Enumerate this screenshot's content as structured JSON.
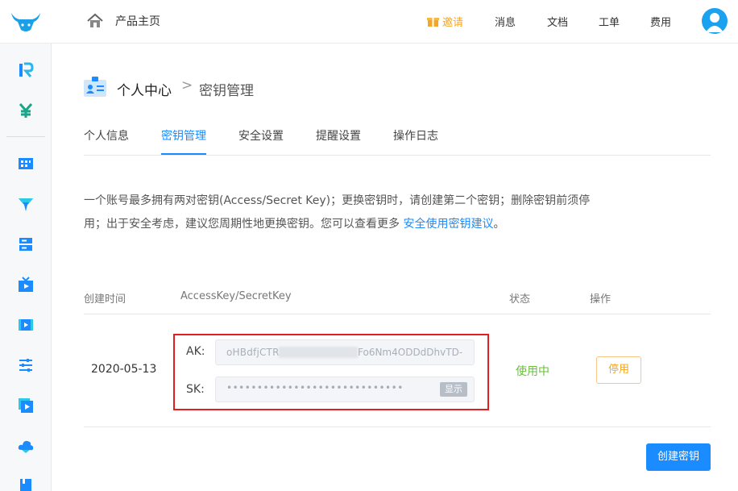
{
  "header": {
    "home_label": "产品主页",
    "nav": {
      "invite": "邀请",
      "messages": "消息",
      "docs": "文档",
      "tickets": "工单",
      "billing": "费用"
    }
  },
  "sidebar": {
    "icons": [
      "r-logo-icon",
      "yen-icon",
      "grid-icon",
      "funnel-icon",
      "server-icon",
      "tv-icon",
      "video-icon",
      "sliders-icon",
      "media-icon",
      "cloud-icon",
      "book-icon"
    ]
  },
  "breadcrumb": {
    "parent": "个人中心",
    "separator": ">",
    "current": "密钥管理"
  },
  "tabs": [
    "个人信息",
    "密钥管理",
    "安全设置",
    "提醒设置",
    "操作日志"
  ],
  "description": {
    "text": "一个账号最多拥有两对密钥(Access/Secret Key)；更换密钥时，请创建第二个密钥；删除密钥前须停用；出于安全考虑，建议您周期性地更换密钥。您可以查看更多 ",
    "link": "安全使用密钥建议",
    "suffix": "。"
  },
  "table": {
    "headers": {
      "created": "创建时间",
      "keys": "AccessKey/SecretKey",
      "status": "状态",
      "actions": "操作"
    },
    "row": {
      "date": "2020-05-13",
      "ak_label": "AK:",
      "ak_prefix": "oHBdfjCTRX",
      "ak_suffix": "Fo6Nm4ODDdDhvTD-",
      "sk_label": "SK:",
      "sk_mask": "••••••••••••••••••••••••••••••••••••••••",
      "show_label": "显示",
      "status": "使用中",
      "disable_label": "停用"
    }
  },
  "create_label": "创建密钥",
  "colors": {
    "accent": "#1a8cff",
    "invite": "#f5a623",
    "status_active": "#67c23a",
    "highlight_box": "#e02020"
  }
}
